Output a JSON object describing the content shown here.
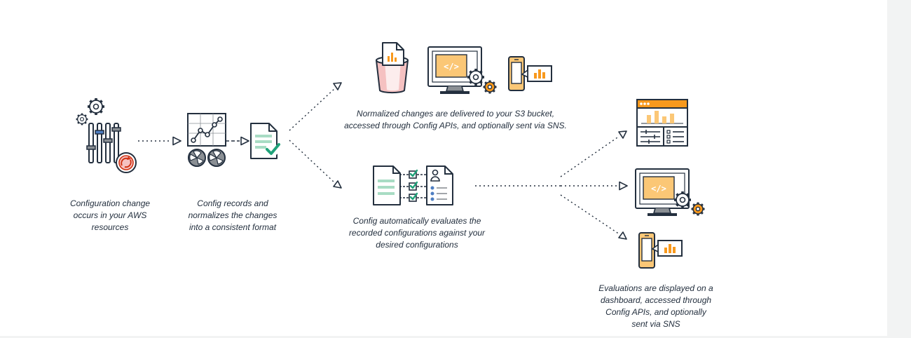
{
  "captions": {
    "step1": [
      "Configuration change",
      "occurs in your AWS",
      "resources"
    ],
    "step2": [
      "Config records and",
      "normalizes the changes",
      "into a consistent format"
    ],
    "delivery": [
      "Normalized changes are delivered to your S3 bucket,",
      "accessed through Config APIs, and optionally sent via SNS."
    ],
    "evaluate": [
      "Config automatically evaluates the",
      "recorded configurations against your",
      "desired configurations"
    ],
    "results": [
      "Evaluations are displayed on a",
      "dashboard, accessed through",
      "Config APIs, and optionally",
      "sent via SNS"
    ]
  },
  "icons": {
    "resources": "configuration-sliders-gears-icon",
    "recorder": "config-record-graph-icon",
    "normalized": "normalized-document-check-icon",
    "s3": "s3-bucket-icon",
    "api": "api-monitor-gear-icon",
    "sns": "sns-mobile-icon",
    "rules": "rules-evaluation-icon",
    "dashboard": "dashboard-icon",
    "api_results": "api-monitor-gear-icon",
    "sns_results": "sns-mobile-icon"
  },
  "colors": {
    "outline": "#232f3e",
    "orange": "#f8991d",
    "light_orange": "#fbc776",
    "green": "#1fa279",
    "light_green": "#a8dcc4",
    "blue": "#4e7ec2",
    "red": "#d13212",
    "pink": "#f5c1c1",
    "gray": "#8a8f94"
  }
}
